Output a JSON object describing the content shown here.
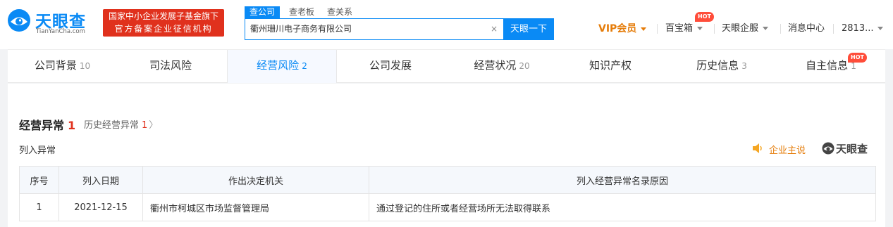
{
  "header": {
    "logo_cn": "天眼查",
    "logo_en": "TianYanCha.com",
    "badge_line1": "国家中小企业发展子基金旗下",
    "badge_line2": "官方备案企业征信机构",
    "search_tabs": [
      "查公司",
      "查老板",
      "查关系"
    ],
    "search_value": "衢州珊川电子商务有限公司",
    "search_clear": "×",
    "search_button": "天眼一下",
    "nav": {
      "vip": "VIP会员",
      "baibao": "百宝箱",
      "hot": "HOT",
      "qifu": "天眼企服",
      "messages": "消息中心",
      "user": "2813..."
    }
  },
  "tabs": [
    {
      "label": "公司背景",
      "count": "10"
    },
    {
      "label": "司法风险",
      "count": ""
    },
    {
      "label": "经营风险",
      "count": "2"
    },
    {
      "label": "公司发展",
      "count": ""
    },
    {
      "label": "经营状况",
      "count": "20"
    },
    {
      "label": "知识产权",
      "count": ""
    },
    {
      "label": "历史信息",
      "count": "3"
    },
    {
      "label": "自主信息",
      "count": "1"
    }
  ],
  "tab_hot": "HOT",
  "section": {
    "title": "经营异常",
    "count": "1",
    "history_label": "历史经营异常",
    "history_count": "1",
    "history_arrow": "〉",
    "subtitle": "列入异常",
    "qiye_say": "企业主说",
    "watermark": "天眼查"
  },
  "table": {
    "headers": [
      "序号",
      "列入日期",
      "作出决定机关",
      "列入经营异常名录原因"
    ],
    "rows": [
      [
        "1",
        "2021-12-15",
        "衢州市柯城区市场监督管理局",
        "通过登记的住所或者经营场所无法取得联系"
      ]
    ]
  },
  "colors": {
    "brand_blue": "#0a8af5",
    "accent_red": "#e0311d",
    "vip_orange": "#e57c09"
  }
}
